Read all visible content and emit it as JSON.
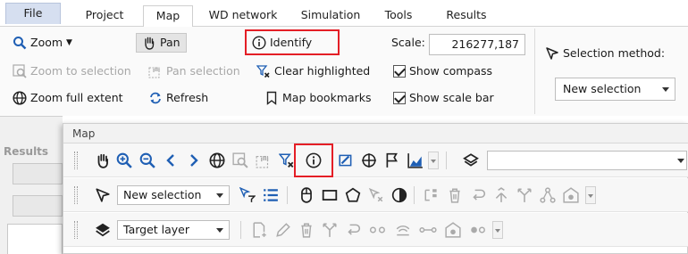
{
  "tabs": [
    "File",
    "Project",
    "Map",
    "WD network",
    "Simulation",
    "Tools",
    "Results"
  ],
  "active_tab": "Map",
  "ribbon": {
    "zoom": "Zoom",
    "pan": "Pan",
    "identify": "Identify",
    "zoom_to_selection": "Zoom to selection",
    "pan_selection": "Pan selection",
    "clear_highlighted": "Clear highlighted",
    "zoom_full_extent": "Zoom full extent",
    "refresh": "Refresh",
    "map_bookmarks": "Map bookmarks",
    "scale_label": "Scale:",
    "scale_value": "216277,187",
    "show_compass": "Show compass",
    "show_scale_bar": "Show scale bar",
    "selection_method_label": "Selection method:",
    "selection_method_value": "New selection"
  },
  "left_panel": {
    "label": "Results"
  },
  "map_window": {
    "title": "Map",
    "row2_selection": "New selection",
    "row3_layer": "Target layer"
  },
  "colors": {
    "highlight": "#e41e26",
    "accent_blue": "#1f5fb4"
  }
}
